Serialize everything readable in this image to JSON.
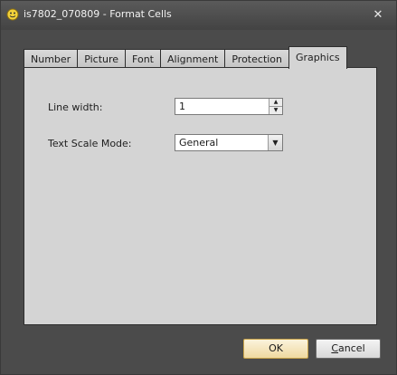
{
  "window": {
    "title": "is7802_070809 - Format Cells",
    "close_glyph": "✕",
    "app_icon": "smiley-icon"
  },
  "tabs": [
    {
      "label": "Number",
      "active": false
    },
    {
      "label": "Picture",
      "active": false
    },
    {
      "label": "Font",
      "active": false
    },
    {
      "label": "Alignment",
      "active": false
    },
    {
      "label": "Protection",
      "active": false
    },
    {
      "label": "Graphics",
      "active": true
    }
  ],
  "graphics": {
    "line_width_label": "Line width:",
    "line_width_value": "1",
    "text_scale_label": "Text Scale Mode:",
    "text_scale_value": "General"
  },
  "buttons": {
    "ok": "OK",
    "cancel": "Cancel"
  },
  "colors": {
    "frame": "#4b4b4b",
    "panel": "#d4d4d4",
    "default_button": "#efd9a0"
  }
}
